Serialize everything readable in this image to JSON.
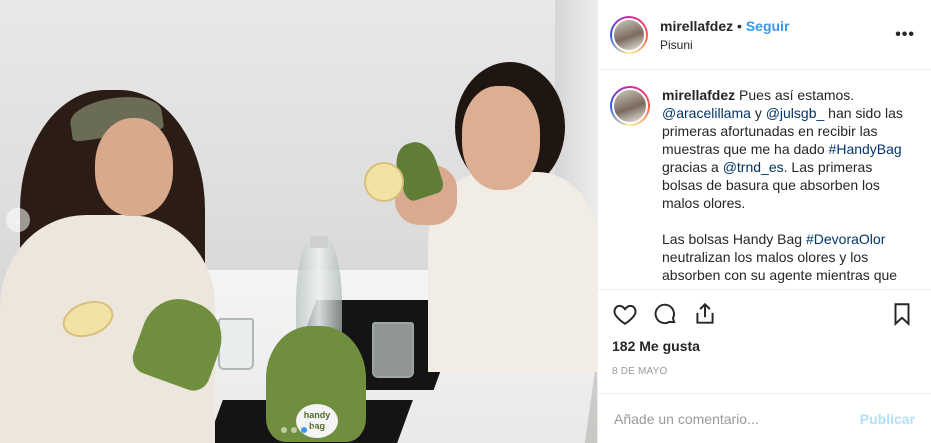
{
  "post": {
    "author": {
      "username": "mirellafdez",
      "separator": "•",
      "follow_label": "Seguir",
      "location": "Pisuni",
      "more_icon": "more-options-icon"
    },
    "caption": {
      "username": "mirellafdez",
      "intro": "Pues así estamos.",
      "mention_1": "@aracelillama",
      "conj": "y",
      "mention_2": "@julsgb_",
      "text_1": "han sido las primeras afortunadas en recibir las muestras que me ha dado",
      "hashtag_1": "#HandyBag",
      "text_2": "gracias a",
      "mention_3": "@trnd_es",
      "text_3": ". Las primeras bolsas de basura que absorben los malos olores.",
      "text_4": "Las bolsas Handy Bag",
      "hashtag_2": "#DevoraOlor",
      "text_5": "neutralizan los malos olores y los absorben con su agente mientras que"
    },
    "photo": {
      "bag_label": "handy bag",
      "prev_icon": "chevron-left-icon",
      "dots": 4,
      "active_dot": 3
    },
    "actions": {
      "icons": [
        "heart-icon",
        "comment-icon",
        "share-icon",
        "bookmark-icon"
      ],
      "likes": "182 Me gusta",
      "date": "8 DE MAYO"
    },
    "comment_box": {
      "placeholder": "Añade un comentario...",
      "post_label": "Publicar"
    }
  },
  "colors": {
    "link": "#003569",
    "follow": "#3897f0",
    "post_disabled": "#b2dffc",
    "meta": "#999999"
  }
}
